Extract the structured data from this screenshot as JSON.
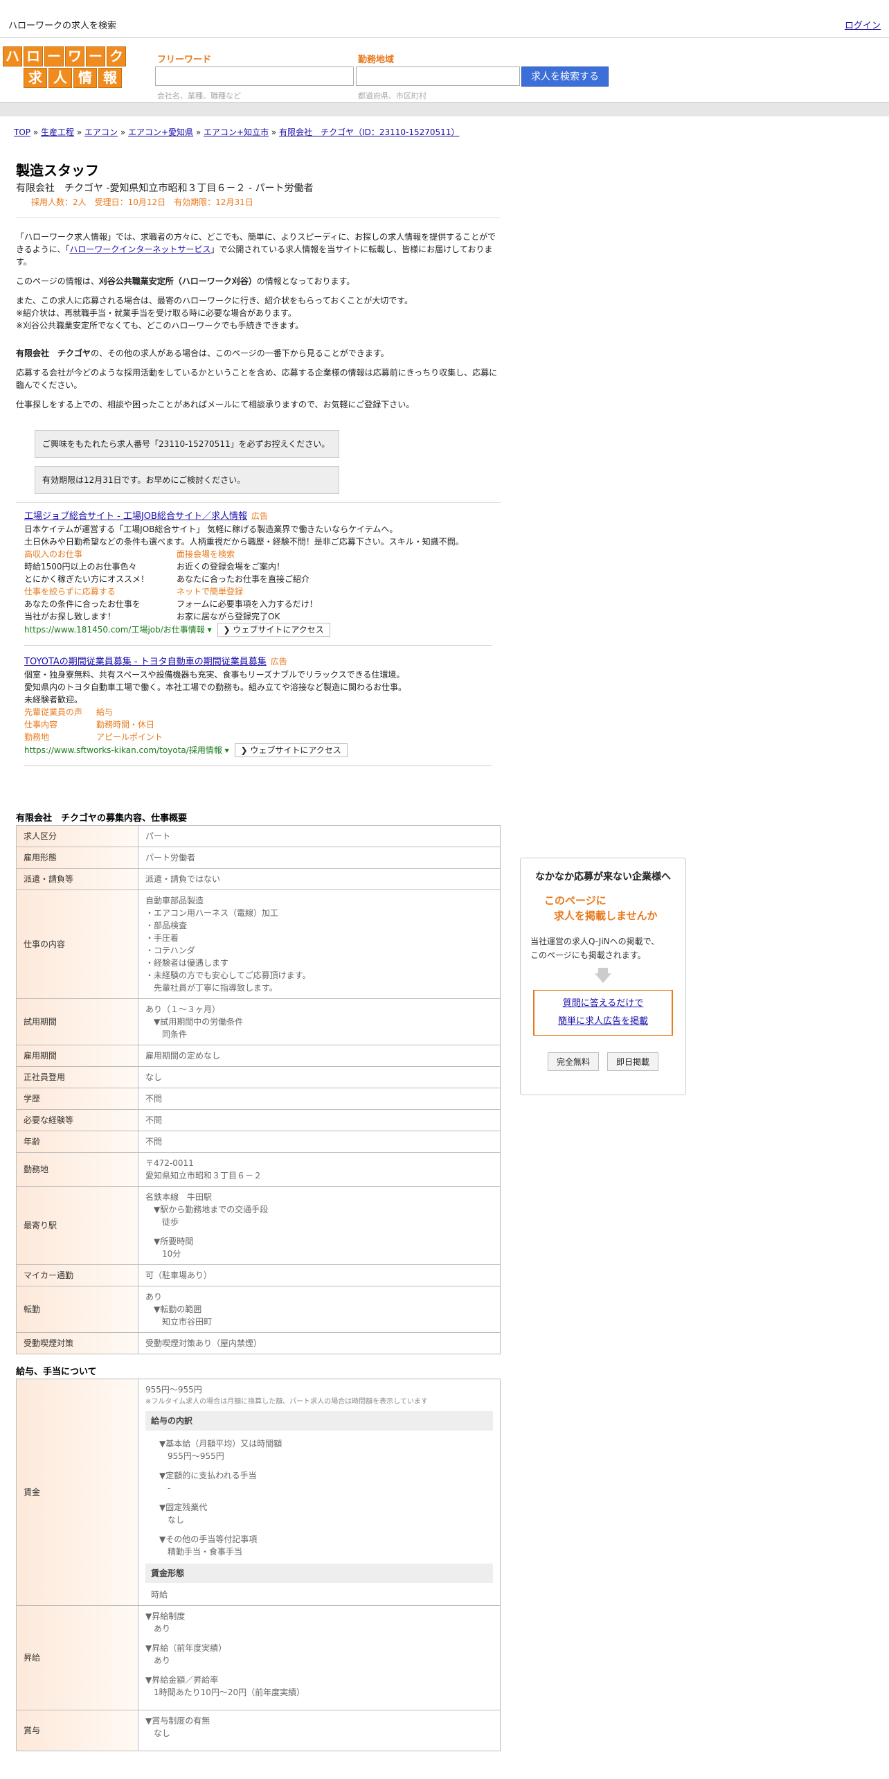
{
  "top": {
    "title": "ハローワークの求人を検索",
    "login": "ログイン"
  },
  "logo": {
    "row1": [
      "ハ",
      "ロ",
      "ー",
      "ワ",
      "ー",
      "ク"
    ],
    "row2": [
      "求",
      "人",
      "情",
      "報"
    ]
  },
  "search": {
    "freeword_label": "フリーワード",
    "freeword_hint": "会社名、業種、職種など",
    "area_label": "勤務地域",
    "area_hint": "都道府県、市区町村",
    "button": "求人を検索する"
  },
  "breadcrumb": [
    "TOP",
    "生産工程",
    "エアコン",
    "エアコン+愛知県",
    "エアコン+知立市",
    "有限会社　チクゴヤ（ID：23110-15270511）"
  ],
  "job": {
    "title": "製造スタッフ",
    "company_line": "有限会社　チクゴヤ -愛知県知立市昭和３丁目６－２ - パート労働者",
    "meta": "採用人数：2人　受理日：10月12日　有効期限：12月31日"
  },
  "intro": {
    "p1a": "「ハローワーク求人情報」では、求職者の方々に、どこでも、簡単に、よりスピーディに、お探しの求人情報を提供することができるように、「",
    "p1link": "ハローワークインターネットサービス",
    "p1b": "」で公開されている求人情報を当サイトに転載し、皆様にお届けしております。",
    "p2a": "このページの情報は、",
    "p2b": "刈谷公共職業安定所（ハローワーク刈谷）",
    "p2c": "の情報となっております。",
    "p3l1": "また、この求人に応募される場合は、最寄のハローワークに行き、紹介状をもらっておくことが大切です。",
    "p3l2": "※紹介状は、再就職手当・就業手当を受け取る時に必要な場合があります。",
    "p3l3": "※刈谷公共職業安定所でなくても、どこのハローワークでも手続きできます。",
    "p4a": "有限会社　チクゴヤ",
    "p4b": "の、その他の求人がある場合は、このページの一番下から見ることができます。",
    "p5": "応募する会社が今どのような採用活動をしているかということを含め、応募する企業様の情報は応募前にきっちり収集し、応募に臨んでください。",
    "p6": "仕事探しをする上での、相談や困ったことがあればメールにて相談承りますので、お気軽にご登録下さい。"
  },
  "notices": [
    "ご興味をもたれたら求人番号「23110-15270511」を必ずお控えください。",
    "有効期限は12月31日です。お早めにご検討ください。"
  ],
  "ads": [
    {
      "title": "工場ジョブ総合サイト - 工場JOB総合サイト／求人情報",
      "tag": "広告",
      "desc1": "日本ケイテムが運営する「工場JOB総合サイト」 気軽に稼げる製造業界で働きたいならケイテムへ。",
      "desc2": "土日休みや日勤希望などの条件も選べます。人柄重視だから職歴・経験不問！是非ご応募下さい。スキル・知識不問。",
      "sitelinks": [
        {
          "h": "高収入のお仕事",
          "d1": "時給1500円以上のお仕事色々",
          "d2": "とにかく稼ぎたい方にオススメ！"
        },
        {
          "h": "面接会場を検索",
          "d1": "お近くの登録会場をご案内！",
          "d2": "あなたに合ったお仕事を直接ご紹介"
        },
        {
          "h": "仕事を絞らずに応募する",
          "d1": "あなたの条件に合ったお仕事を",
          "d2": "当社がお探し致します！"
        },
        {
          "h": "ネットで簡単登録",
          "d1": "フォームに必要事項を入力するだけ！",
          "d2": "お家に居ながら登録完了OK"
        }
      ],
      "url": "https://www.181450.com/工場job/お仕事情報",
      "visit": "ウェブサイトにアクセス"
    },
    {
      "title": "TOYOTAの期間従業員募集 - トヨタ自動車の期間従業員募集",
      "tag": "広告",
      "desc1": "個室・独身寮無料、共有スペースや設備機器も充実、食事もリーズナブルでリラックスできる住環境。",
      "desc2": "愛知県内のトヨタ自動車工場で働く。本社工場での勤務も。組み立てや溶接など製造に関わるお仕事。",
      "desc3": "未経験者歓迎。",
      "links": [
        "先輩従業員の声",
        "給与",
        "仕事内容",
        "勤務時間・休日",
        "勤務地",
        "アピールポイント"
      ],
      "url": "https://www.sftworks-kikan.com/toyota/採用情報",
      "visit": "ウェブサイトにアクセス"
    }
  ],
  "section1": {
    "title": "有限会社　チクゴヤの募集内容、仕事概要",
    "rows": [
      {
        "k": "求人区分",
        "v": [
          "パート"
        ]
      },
      {
        "k": "雇用形態",
        "v": [
          "パート労働者"
        ]
      },
      {
        "k": "派遣・請負等",
        "v": [
          "派遣・請負ではない"
        ]
      },
      {
        "k": "仕事の内容",
        "v": [
          "自動車部品製造",
          "・エアコン用ハーネス（電線）加工",
          "・部品検査",
          "・手圧着",
          "・コテハンダ",
          "・経験者は優遇します",
          "・未経験の方でも安心してご応募頂けます。",
          "　先輩社員が丁寧に指導致します。"
        ]
      },
      {
        "k": "試用期間",
        "v": [
          "あり（１～３ヶ月）"
        ],
        "sub": [
          "▼試用期間中の労働条件",
          "　同条件"
        ]
      },
      {
        "k": "雇用期間",
        "v": [
          "雇用期間の定めなし"
        ]
      },
      {
        "k": "正社員登用",
        "v": [
          "なし"
        ]
      },
      {
        "k": "学歴",
        "v": [
          "不問"
        ]
      },
      {
        "k": "必要な経験等",
        "v": [
          "不問"
        ]
      },
      {
        "k": "年齢",
        "v": [
          "不問"
        ]
      },
      {
        "k": "勤務地",
        "v": [
          "〒472-0011",
          "愛知県知立市昭和３丁目６－２"
        ]
      },
      {
        "k": "最寄り駅",
        "v": [
          "名鉄本線　牛田駅"
        ],
        "sub": [
          "▼駅から勤務地までの交通手段",
          "　徒歩",
          "",
          "▼所要時間",
          "　10分"
        ]
      },
      {
        "k": "マイカー通勤",
        "v": [
          "可（駐車場あり）"
        ]
      },
      {
        "k": "転勤",
        "v": [
          "あり"
        ],
        "sub": [
          "▼転勤の範囲",
          "　知立市谷田町"
        ]
      },
      {
        "k": "受動喫煙対策",
        "v": [
          "受動喫煙対策あり（屋内禁煙）"
        ]
      }
    ]
  },
  "section2": {
    "title": "給与、手当について",
    "wage_key": "賃金",
    "wage_value": "955円〜955円",
    "wage_note": "※フルタイム求人の場合は月額に換算した額、パート求人の場合は時間額を表示しています",
    "breakdown_head": "給与の内訳",
    "breakdown": [
      {
        "h": "▼基本給（月額平均）又は時間額",
        "v": "955円〜955円"
      },
      {
        "h": "▼定額的に支払われる手当",
        "v": "-"
      },
      {
        "h": "▼固定残業代",
        "v": "なし"
      },
      {
        "h": "▼その他の手当等付記事項",
        "v": "精勤手当・食事手当"
      }
    ],
    "form_head": "賃金形態",
    "form_value": "時給",
    "raise_key": "昇給",
    "raise": [
      {
        "h": "▼昇給制度",
        "v": "あり"
      },
      {
        "h": "▼昇給（前年度実績）",
        "v": "あり"
      },
      {
        "h": "▼昇給金額／昇給率",
        "v": "1時間あたり10円〜20円（前年度実績）"
      }
    ],
    "bonus_key": "賞与",
    "bonus": [
      {
        "h": "▼賞与制度の有無",
        "v": "なし"
      }
    ]
  },
  "sidebox": {
    "head": "なかなか応募が来ない企業様へ",
    "offer1": "このページに",
    "offer2": "求人を掲載しませんか",
    "desc1": "当社運営の求人Q-JiNへの掲載で、",
    "desc2": "このページにも掲載されます。",
    "link1": "質問に答えるだけで",
    "link2": "簡単に求人広告を掲載",
    "btn1": "完全無料",
    "btn2": "即日掲載"
  }
}
